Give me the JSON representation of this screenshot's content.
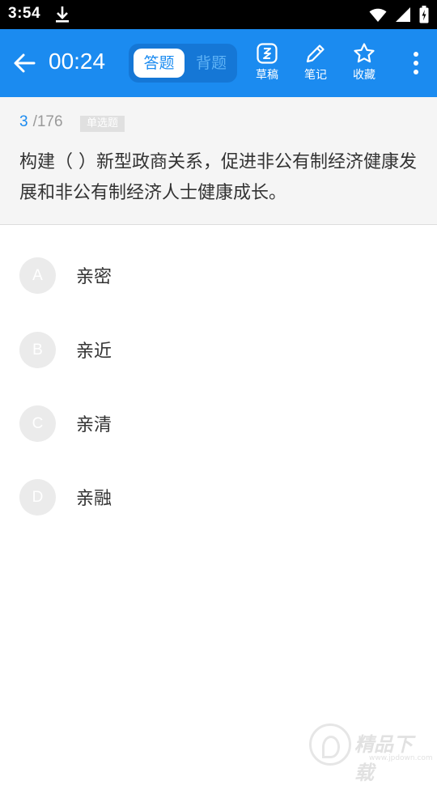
{
  "status_bar": {
    "time": "3:54"
  },
  "app_bar": {
    "timer": "00:24",
    "tabs": [
      {
        "label": "答题",
        "active": true
      },
      {
        "label": "背题",
        "active": false
      }
    ],
    "tools": [
      {
        "icon": "draft-icon",
        "label": "草稿"
      },
      {
        "icon": "pencil-icon",
        "label": "笔记"
      },
      {
        "icon": "star-icon",
        "label": "收藏"
      }
    ]
  },
  "question": {
    "current": "3",
    "total": "/176",
    "type": "单选题",
    "text": "构建（ ）新型政商关系，促进非公有制经济健康发展和非公有制经济人士健康成长。"
  },
  "options": [
    {
      "letter": "A",
      "text": "亲密"
    },
    {
      "letter": "B",
      "text": "亲近"
    },
    {
      "letter": "C",
      "text": "亲清"
    },
    {
      "letter": "D",
      "text": "亲融"
    }
  ],
  "watermark": {
    "text": "精品下载",
    "sub": "www.jpdown.com"
  },
  "colors": {
    "primary": "#1b8bf0",
    "question_bg": "#f5f5f5",
    "option_circle": "#ebebeb"
  }
}
